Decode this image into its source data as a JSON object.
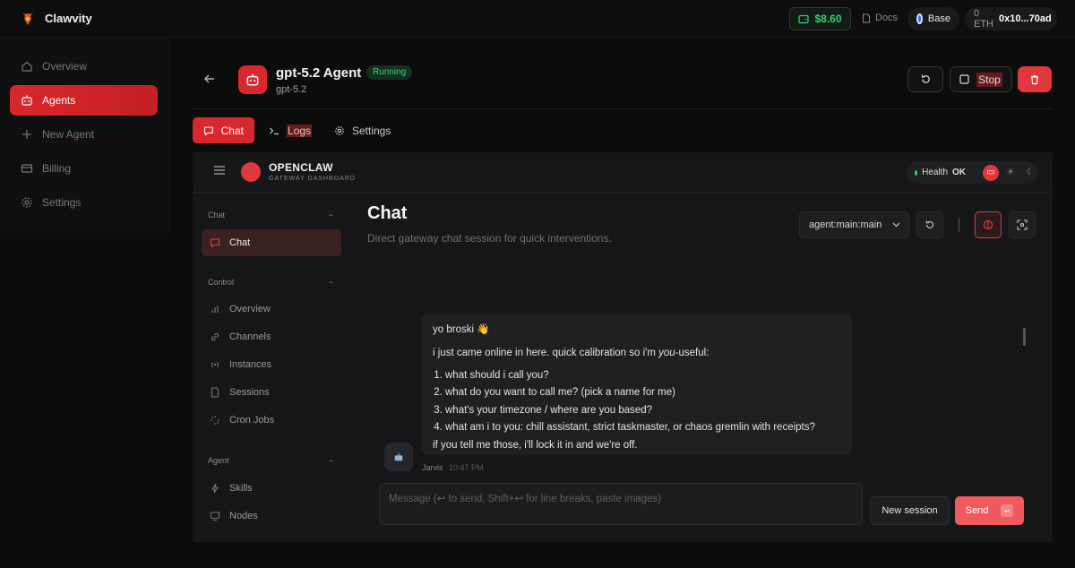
{
  "app": {
    "brand": "Clawvity",
    "balance": "$8.60",
    "docs_label": "Docs",
    "network": "Base",
    "eth_balance": "0 ETH",
    "wallet": "0x10...70ad"
  },
  "sidebar": {
    "items": [
      {
        "label": "Overview",
        "icon": "home-icon"
      },
      {
        "label": "Agents",
        "icon": "robot-icon",
        "active": true
      },
      {
        "label": "New Agent",
        "icon": "plus-icon"
      },
      {
        "label": "Billing",
        "icon": "card-icon"
      },
      {
        "label": "Settings",
        "icon": "gear-icon"
      }
    ]
  },
  "agent": {
    "name": "gpt-5.2 Agent",
    "status": "Running",
    "model": "gpt-5.2",
    "stop_label": "Stop"
  },
  "tabs": [
    {
      "label": "Chat",
      "active": true
    },
    {
      "label": "Logs"
    },
    {
      "label": "Settings"
    }
  ],
  "gateway": {
    "title": "OPENCLAW",
    "subtitle": "GATEWAY DASHBOARD",
    "health_label": "Health",
    "health_value": "OK",
    "nav": {
      "section_chat": "Chat",
      "section_control": "Control",
      "section_agent": "Agent",
      "items": [
        "Chat",
        "Overview",
        "Channels",
        "Instances",
        "Sessions",
        "Cron Jobs",
        "Skills",
        "Nodes"
      ]
    },
    "chat": {
      "title": "Chat",
      "description": "Direct gateway chat session for quick interventions.",
      "session": "agent:main:main",
      "message": {
        "greeting": "yo broski 👋",
        "intro_before": "i just came online in here. quick calibration so i'm ",
        "intro_em": "you",
        "intro_after": "-useful:",
        "questions": [
          "what should i call you?",
          "what do you want to call me? (pick a name for me)",
          "what's your timezone / where are you based?",
          "what am i to you: chill assistant, strict taskmaster, or chaos gremlin with receipts?"
        ],
        "closing": "if you tell me those, i'll lock it in and we're off.",
        "sender": "Jarvis",
        "time": "10:47 PM"
      },
      "composer_placeholder": "Message (↩ to send, Shift+↩ for line breaks, paste images)",
      "new_session_label": "New session",
      "send_label": "Send"
    }
  },
  "colors": {
    "accent": "#d9282d",
    "success": "#34d36a",
    "background": "#0c0c0c"
  }
}
